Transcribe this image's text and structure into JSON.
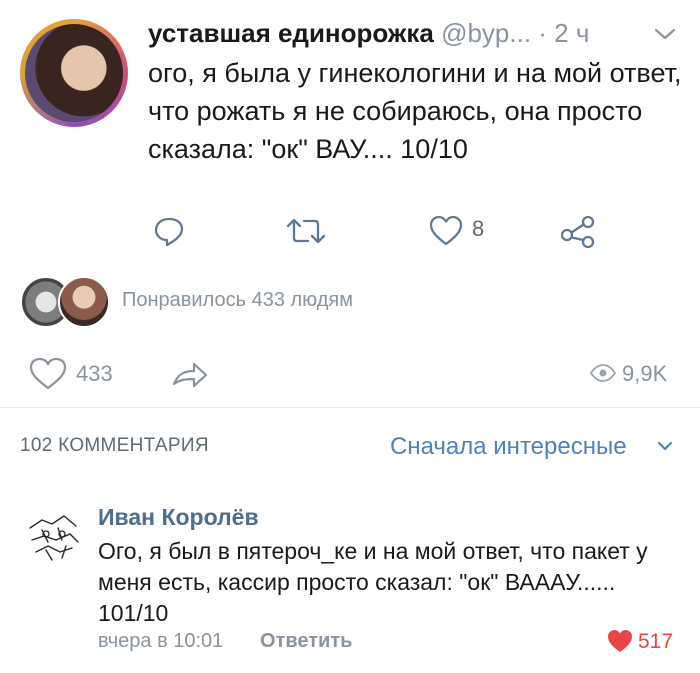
{
  "tweet": {
    "name": "уставшая единорожка",
    "handle": "@byp...",
    "time": "· 2 ч",
    "text": "ого, я была у гинекологини и на мой ответ, что рожать я не собираюсь, она просто сказала: \"ок\" ВАУ.... 10/10",
    "like_count": "8"
  },
  "liked_by": {
    "text": "Понравилось 433 людям"
  },
  "stats": {
    "likes": "433",
    "views": "9,9K"
  },
  "comments_header": {
    "count_label": "102 КОММЕНТАРИЯ",
    "sort_label": "Сначала интересные"
  },
  "comment": {
    "author": "Иван Королёв",
    "text": "Ого, я был в пятероч_ке и на мой ответ, что пакет у меня есть, кассир просто сказал: \"ок\" ВААAУ...... 101/10",
    "time": "вчера в 10:01",
    "reply_label": "Ответить",
    "likes": "517"
  },
  "colors": {
    "accent": "#5181b8",
    "author": "#4f6e8c",
    "like_red": "#e64646",
    "muted": "#8a949e"
  }
}
